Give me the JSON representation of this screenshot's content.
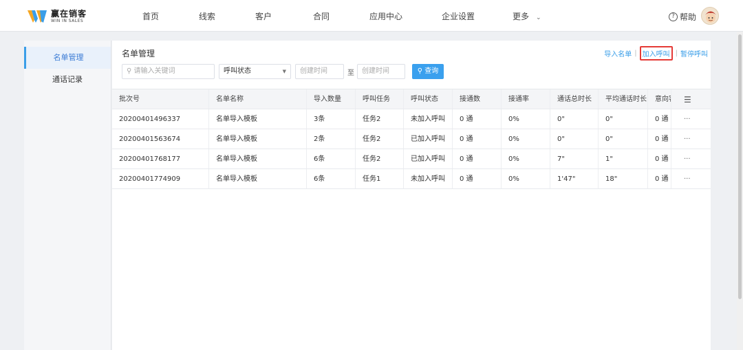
{
  "brand": {
    "name": "赢在销客",
    "tagline": "WIN IN SALES"
  },
  "nav": [
    "首页",
    "线索",
    "客户",
    "合同",
    "应用中心",
    "企业设置",
    "更多"
  ],
  "help_label": "帮助",
  "sidebar": {
    "items": [
      {
        "label": "名单管理",
        "active": true
      },
      {
        "label": "通话记录",
        "active": false
      }
    ]
  },
  "page_title": "名单管理",
  "actions": {
    "import": "导入名单",
    "add_call": "加入呼叫",
    "pause_call": "暂停呼叫"
  },
  "filters": {
    "keyword_placeholder": "请输入关键词",
    "status_select": "呼叫状态",
    "start_placeholder": "创建时间",
    "to_label": "至",
    "end_placeholder": "创建时间",
    "query_label": "查询"
  },
  "table": {
    "headers": [
      "批次号",
      "名单名称",
      "导入数量",
      "呼叫任务",
      "呼叫状态",
      "接通数",
      "接通率",
      "通话总时长",
      "平均通话时长",
      "意向客"
    ],
    "rows": [
      [
        "20200401496337",
        "名单导入模板",
        "3条",
        "任务2",
        "未加入呼叫",
        "0 通",
        "0%",
        "0\"",
        "0\"",
        "0 通"
      ],
      [
        "20200401563674",
        "名单导入模板",
        "2条",
        "任务2",
        "已加入呼叫",
        "0 通",
        "0%",
        "0\"",
        "0\"",
        "0 通"
      ],
      [
        "20200401768177",
        "名单导入模板",
        "6条",
        "任务2",
        "已加入呼叫",
        "0 通",
        "0%",
        "7\"",
        "1\"",
        "0 通"
      ],
      [
        "20200401774909",
        "名单导入模板",
        "6条",
        "任务1",
        "未加入呼叫",
        "0 通",
        "0%",
        "1'47\"",
        "18\"",
        "0 通"
      ]
    ],
    "row_action": "···"
  },
  "colors": {
    "accent": "#3aa0ee",
    "highlight_border": "#e53935"
  }
}
